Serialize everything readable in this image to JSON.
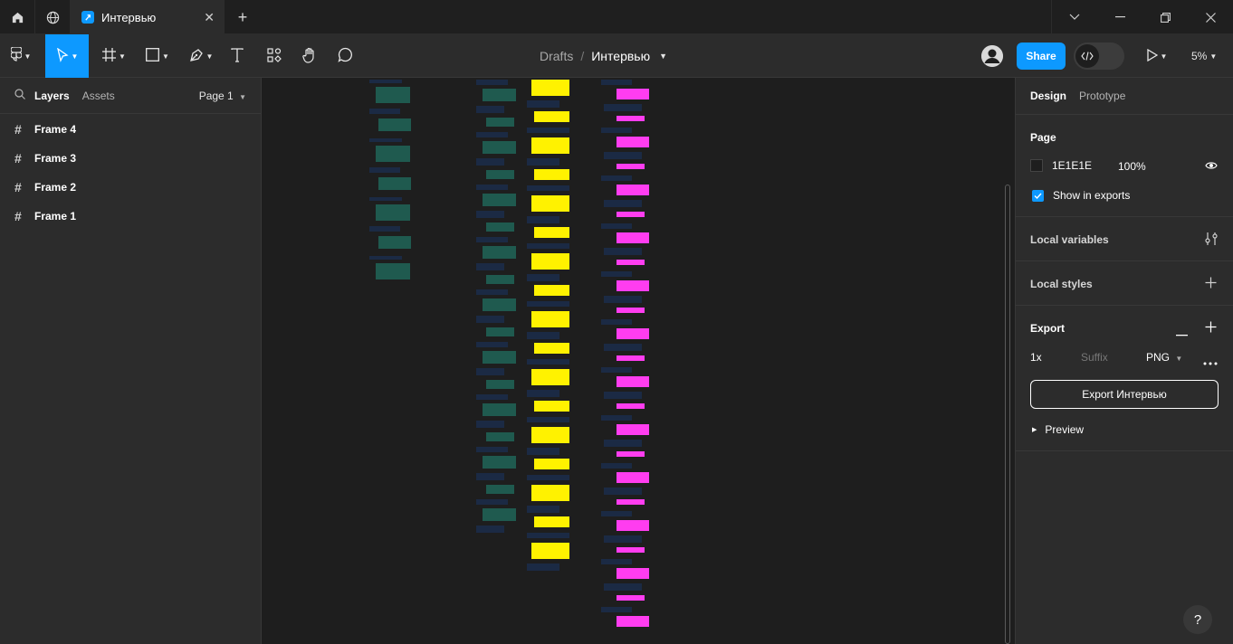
{
  "tabbar": {
    "tab_title": "Интервью",
    "tab_close": "✕",
    "new_tab": "+"
  },
  "toolbar": {
    "breadcrumb_drafts": "Drafts",
    "breadcrumb_sep": "/",
    "file_title": "Интервью",
    "share_label": "Share",
    "zoom_label": "5%"
  },
  "left_panel": {
    "tab_layers": "Layers",
    "tab_assets": "Assets",
    "page_selector": "Page 1",
    "layers": [
      {
        "label": "Frame 4"
      },
      {
        "label": "Frame 3"
      },
      {
        "label": "Frame 2"
      },
      {
        "label": "Frame 1"
      }
    ]
  },
  "right_panel": {
    "tab_design": "Design",
    "tab_prototype": "Prototype",
    "page_section_title": "Page",
    "page_color_hex": "1E1E1E",
    "page_opacity": "100%",
    "show_in_exports_label": "Show in exports",
    "local_variables_label": "Local variables",
    "local_styles_label": "Local styles",
    "export_title": "Export",
    "export_scale": "1x",
    "export_suffix_placeholder": "Suffix",
    "export_format": "PNG",
    "export_button_label": "Export Интервью",
    "preview_label": "Preview"
  },
  "colors": {
    "accent": "#0d99ff",
    "canvas": "#1e1e1e",
    "panel": "#2c2c2c",
    "note_yellow": "#fff200",
    "note_pink": "#ff3df0",
    "note_teal": "#1f5a4f",
    "note_navy": "#1b2a44"
  }
}
